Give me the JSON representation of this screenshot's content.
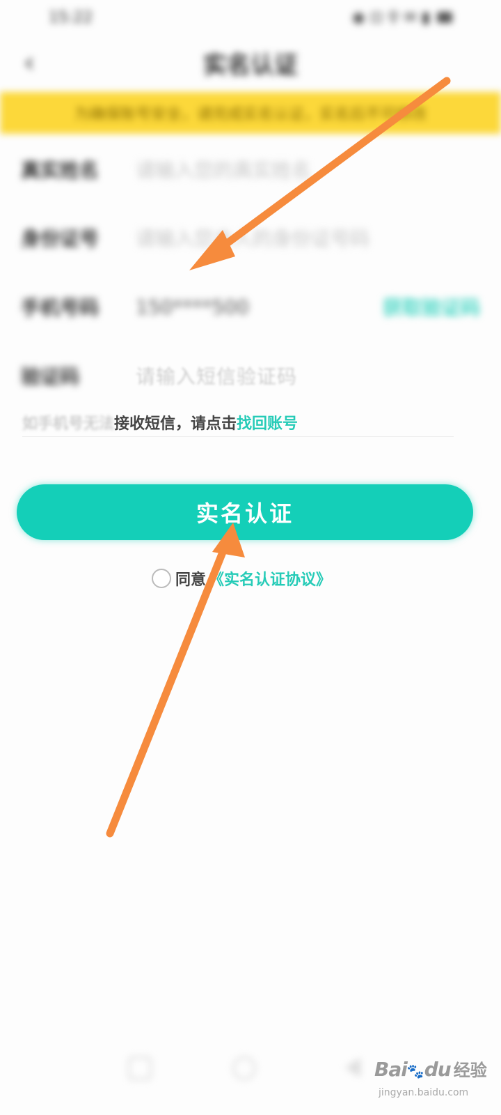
{
  "status_bar": {
    "time": "15:22",
    "right": "◉ ⊡ ⚲ ✉ ▮"
  },
  "nav": {
    "back_glyph": "‹",
    "title": "实名认证"
  },
  "banner": {
    "text": "为确保账号安全，请完成实名认证，实名后不可修改"
  },
  "form": {
    "name": {
      "label": "真实姓名",
      "placeholder": "请输入您的真实姓名"
    },
    "id": {
      "label": "身份证号",
      "placeholder": "请输入您本人的身份证号码"
    },
    "phone": {
      "label": "手机号码",
      "value": "150****500",
      "action": "获取验证码"
    },
    "code": {
      "label": "验证码",
      "placeholder": "请输入短信验证码"
    }
  },
  "hint": {
    "faded": "如手机号无法",
    "main": "接收短信，请点击",
    "link": "找回账号"
  },
  "submit_label": "实名认证",
  "agreement": {
    "prefix": "同意",
    "link": "《实名认证协议》"
  },
  "watermark": {
    "brand": "Bai",
    "paw": "🐾",
    "brand2": "du",
    "cn": "经验",
    "url": "jingyan.baidu.com"
  },
  "colors": {
    "accent": "#14cfb8",
    "banner": "#fcd83a",
    "arrow": "#f68b3d"
  },
  "icons": [
    "back-arrow-icon",
    "radio-unchecked-icon",
    "orange-annotation-arrow",
    "recent-apps-icon",
    "home-icon",
    "back-triangle-icon"
  ]
}
